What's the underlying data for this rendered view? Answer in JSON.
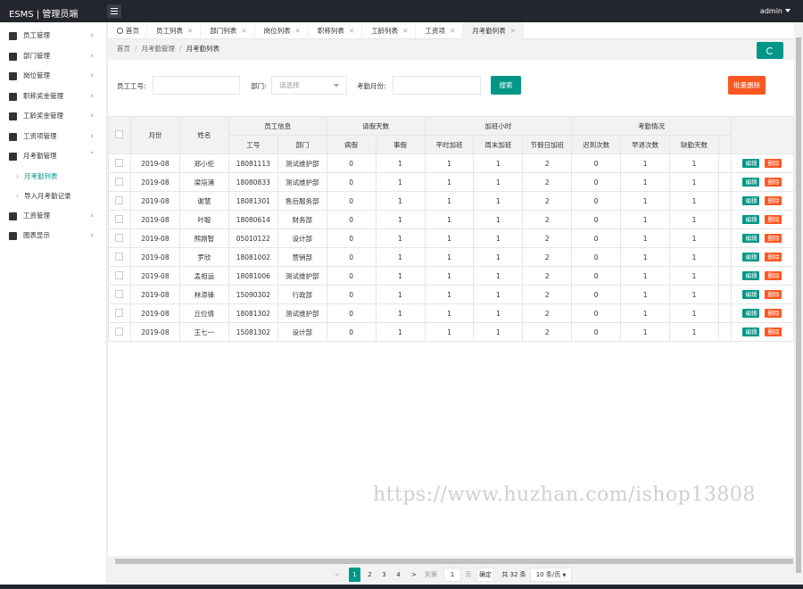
{
  "header": {
    "brand": "ESMS | 管理员端",
    "user": "admin"
  },
  "sidebar": {
    "items": [
      {
        "label": "员工管理",
        "icon": "users-icon"
      },
      {
        "label": "部门管理",
        "icon": "sitemap-icon"
      },
      {
        "label": "岗位管理",
        "icon": "id-card-icon"
      },
      {
        "label": "职称奖金管理",
        "icon": "briefcase-icon"
      },
      {
        "label": "工龄奖金管理",
        "icon": "building-icon"
      },
      {
        "label": "工资项管理",
        "icon": "list-icon"
      },
      {
        "label": "月考勤管理",
        "icon": "layers-icon",
        "expanded": true
      }
    ],
    "sub_items": [
      {
        "label": "月考勤列表",
        "active": true
      },
      {
        "label": "导入月考勤记录",
        "active": false
      }
    ],
    "items_after": [
      {
        "label": "工资管理",
        "icon": "tag-icon"
      },
      {
        "label": "图表显示",
        "icon": "chart-file-icon"
      }
    ]
  },
  "tabs": [
    {
      "label": "首页",
      "closable": false
    },
    {
      "label": "员工列表",
      "closable": true
    },
    {
      "label": "部门列表",
      "closable": true
    },
    {
      "label": "岗位列表",
      "closable": true
    },
    {
      "label": "职称列表",
      "closable": true
    },
    {
      "label": "工龄列表",
      "closable": true
    },
    {
      "label": "工资项",
      "closable": true
    },
    {
      "label": "月考勤列表",
      "closable": true,
      "active": true
    }
  ],
  "breadcrumb": [
    "首页",
    "月考勤管理",
    "月考勤列表"
  ],
  "filters": {
    "employee_no_label": "员工工号:",
    "dept_label": "部门:",
    "dept_placeholder": "请选择",
    "month_label": "考勤月份:",
    "search_button": "搜索",
    "batch_delete_button": "批量删除"
  },
  "table": {
    "group_headers": [
      "员工信息",
      "请假天数",
      "加班小时",
      "考勤情况"
    ],
    "headers": {
      "month": "月份",
      "name": "姓名",
      "emp_no": "工号",
      "dept": "部门",
      "sick": "病假",
      "personal": "事假",
      "weekday_ot": "平时加班",
      "weekend_ot": "周末加班",
      "holiday_ot": "节假日加班",
      "late": "迟到次数",
      "early": "早退次数",
      "absent": "缺勤天数"
    },
    "edit_label": "编辑",
    "delete_label": "删除",
    "rows": [
      {
        "month": "2019-08",
        "name": "郑小伦",
        "emp_no": "18081113",
        "dept": "测试维护部",
        "sick": "0",
        "personal": "1",
        "weekday_ot": "1",
        "weekend_ot": "1",
        "holiday_ot": "2",
        "late": "0",
        "early": "1",
        "absent": "1"
      },
      {
        "month": "2019-08",
        "name": "梁培涌",
        "emp_no": "18080833",
        "dept": "测试维护部",
        "sick": "0",
        "personal": "1",
        "weekday_ot": "1",
        "weekend_ot": "1",
        "holiday_ot": "2",
        "late": "0",
        "early": "1",
        "absent": "1"
      },
      {
        "month": "2019-08",
        "name": "谢慧",
        "emp_no": "18081301",
        "dept": "售后服务部",
        "sick": "0",
        "personal": "1",
        "weekday_ot": "1",
        "weekend_ot": "1",
        "holiday_ot": "2",
        "late": "0",
        "early": "1",
        "absent": "1"
      },
      {
        "month": "2019-08",
        "name": "叶聪",
        "emp_no": "18080614",
        "dept": "财务部",
        "sick": "0",
        "personal": "1",
        "weekday_ot": "1",
        "weekend_ot": "1",
        "holiday_ot": "2",
        "late": "0",
        "early": "1",
        "absent": "1"
      },
      {
        "month": "2019-08",
        "name": "熊刚智",
        "emp_no": "05010122",
        "dept": "设计部",
        "sick": "0",
        "personal": "1",
        "weekday_ot": "1",
        "weekend_ot": "1",
        "holiday_ot": "2",
        "late": "0",
        "early": "1",
        "absent": "1"
      },
      {
        "month": "2019-08",
        "name": "罗欣",
        "emp_no": "18081002",
        "dept": "营销部",
        "sick": "0",
        "personal": "1",
        "weekday_ot": "1",
        "weekend_ot": "1",
        "holiday_ot": "2",
        "late": "0",
        "early": "1",
        "absent": "1"
      },
      {
        "month": "2019-08",
        "name": "孟祖运",
        "emp_no": "18081006",
        "dept": "测试维护部",
        "sick": "0",
        "personal": "1",
        "weekday_ot": "1",
        "weekend_ot": "1",
        "holiday_ot": "2",
        "late": "0",
        "early": "1",
        "absent": "1"
      },
      {
        "month": "2019-08",
        "name": "林添锋",
        "emp_no": "15090302",
        "dept": "行政部",
        "sick": "0",
        "personal": "1",
        "weekday_ot": "1",
        "weekend_ot": "1",
        "holiday_ot": "2",
        "late": "0",
        "early": "1",
        "absent": "1"
      },
      {
        "month": "2019-08",
        "name": "丘位倩",
        "emp_no": "18081302",
        "dept": "测试维护部",
        "sick": "0",
        "personal": "1",
        "weekday_ot": "1",
        "weekend_ot": "1",
        "holiday_ot": "2",
        "late": "0",
        "early": "1",
        "absent": "1"
      },
      {
        "month": "2019-08",
        "name": "王七一",
        "emp_no": "15081302",
        "dept": "设计部",
        "sick": "0",
        "personal": "1",
        "weekday_ot": "1",
        "weekend_ot": "1",
        "holiday_ot": "2",
        "late": "0",
        "early": "1",
        "absent": "1"
      }
    ]
  },
  "pagination": {
    "prev": "<",
    "next": ">",
    "pages": [
      "1",
      "2",
      "3",
      "4"
    ],
    "current": "1",
    "goto_label": "到第",
    "goto_value": "1",
    "page_suffix": "页",
    "confirm": "确定",
    "total": "共 32 条",
    "page_size": "10 条/页"
  },
  "watermark": "https://www.huzhan.com/ishop13808",
  "colors": {
    "primary": "#009688",
    "danger": "#ff5722",
    "header": "#23262e"
  }
}
